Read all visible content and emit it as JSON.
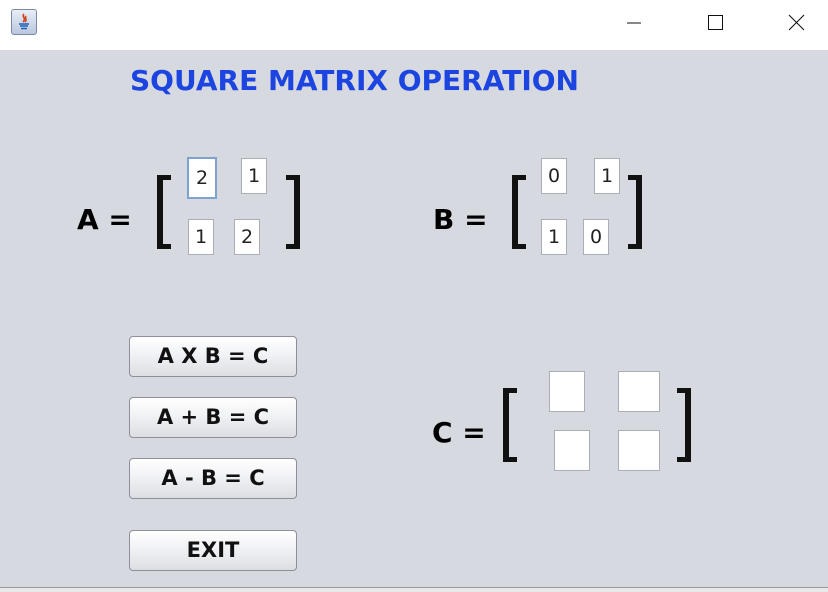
{
  "window": {
    "icon": "java-app-icon",
    "controls": [
      "minimize-icon",
      "maximize-icon",
      "close-icon"
    ]
  },
  "title": "SQUARE MATRIX OPERATION",
  "matrix_a": {
    "label": "A =",
    "values": [
      "2",
      "1",
      "1",
      "2"
    ]
  },
  "matrix_b": {
    "label": "B =",
    "values": [
      "0",
      "1",
      "1",
      "0"
    ]
  },
  "matrix_c": {
    "label": "C =",
    "values": [
      "",
      "",
      "",
      ""
    ]
  },
  "buttons": {
    "multiply": "A X B = C",
    "add": "A + B = C",
    "subtract": "A - B = C",
    "exit": "EXIT"
  }
}
